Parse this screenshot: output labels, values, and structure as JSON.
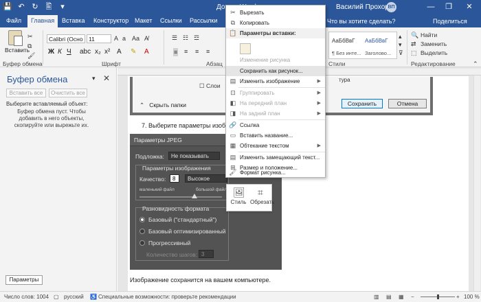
{
  "window": {
    "doc_title": "Док... - Word",
    "user_name": "Василий Прохоров",
    "user_initials": "ВП",
    "minimize": "—",
    "restore": "❐",
    "close": "✕"
  },
  "quick_access": {
    "save": "💾",
    "undo": "↶",
    "redo": "↻",
    "open": "🖺",
    "more": "▾"
  },
  "tabs": [
    {
      "label": "Файл"
    },
    {
      "label": "Главная"
    },
    {
      "label": "Вставка"
    },
    {
      "label": "Конструктор"
    },
    {
      "label": "Макет"
    },
    {
      "label": "Ссылки"
    },
    {
      "label": "Рассылки"
    }
  ],
  "tellme": "Что вы хотите сделать?",
  "share": "Поделиться",
  "ribbon": {
    "paste_label": "Вставить",
    "clipboard_group": "Буфер обмена",
    "font_group": "Шрифт",
    "paragraph_group": "Абзац",
    "styles_group": "Стили",
    "editing_group": "Редактирование",
    "font_name": "Calibri (Осно",
    "font_size": "11",
    "bold": "Ж",
    "italic": "К",
    "underline": "Ч",
    "style1_sample": "АаБбВвГ",
    "style1_name": "¶ Без инте...",
    "style2_sample": "АаБбВвГ",
    "style2_name": "Заголово...",
    "find": "Найти",
    "replace": "Заменить",
    "select": "Выделить"
  },
  "clipboard_pane": {
    "title": "Буфер обмена",
    "close": "✕",
    "paste_all": "Вставить все",
    "clear_all": "Очистить все",
    "prompt": "Выберите вставляемый объект:",
    "empty_message": "Буфер обмена пуст. Чтобы добавить в него объекты, скопируйте или вырежьте их.",
    "options_button": "Параметры"
  },
  "document": {
    "hide_folders": "Скрыть папки",
    "checkbox_label": "Слои",
    "object_label": "тура",
    "save_button": "Сохранить",
    "cancel_button": "Отмена",
    "step_text": "7.    Выберите параметры изобр",
    "result_text": "Изображение сохранится на вашем компьютере."
  },
  "jpeg_dialog": {
    "title": "Параметры JPEG",
    "matte_label": "Подложка:",
    "matte_value": "Не показывать",
    "image_options": "Параметры изображения",
    "quality_label": "Качество:",
    "quality_value": "8",
    "quality_level": "Высокое",
    "small_file": "маленький файл",
    "large_file": "большой файл",
    "format_options": "Разновидность формата",
    "baseline_standard": "Базовый (\"стандартный\")",
    "baseline_optimized": "Базовый оптимизированный",
    "progressive": "Прогрессивный",
    "scans_label": "Количество шагов:",
    "scans_value": "3"
  },
  "mini_toolbar": {
    "style": "Стиль",
    "crop": "Обрезать"
  },
  "context_menu": {
    "cut": "Вырезать",
    "copy": "Копировать",
    "paste_options": "Параметры вставки:",
    "change_picture": "Изменение рисунка",
    "save_as_picture": "Сохранить как рисунок...",
    "edit_image": "Изменить изображение",
    "group": "Группировать",
    "bring_forward": "На передний план",
    "send_backward": "На задний план",
    "link": "Ссылка",
    "insert_caption": "Вставить название...",
    "wrap_text": "Обтекание текстом",
    "edit_alt_text": "Изменить замещающий текст...",
    "size_position": "Размер и положение...",
    "format_picture": "Формат рисунка..."
  },
  "status_bar": {
    "word_count": "Число слов: 1004",
    "language": "русский",
    "accessibility": "Специальные возможности: проверьте рекомендации",
    "zoom": "100 %"
  }
}
